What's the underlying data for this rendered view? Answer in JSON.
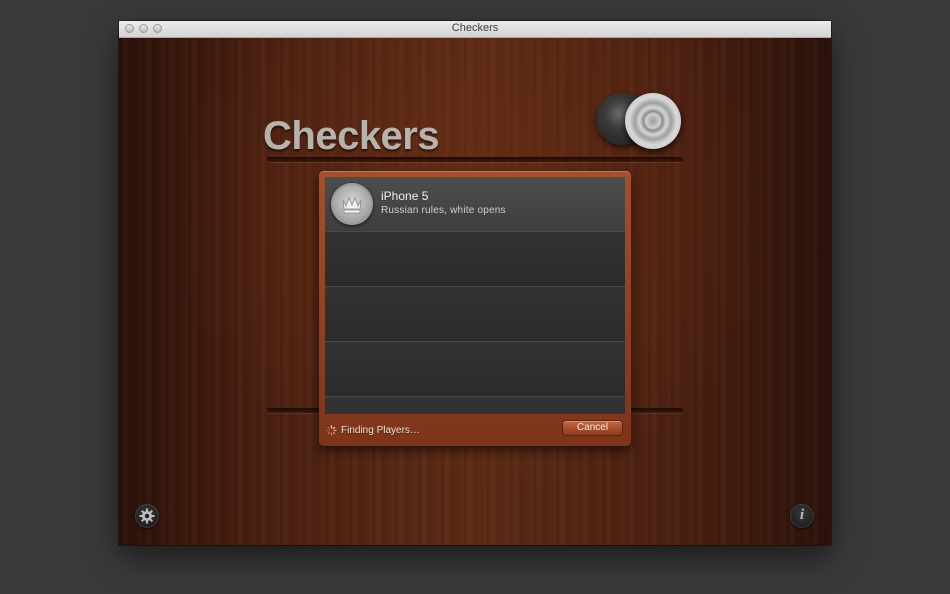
{
  "window": {
    "title": "Checkers"
  },
  "app": {
    "title": "Checkers"
  },
  "players": [
    {
      "name": "iPhone 5",
      "rules": "Russian rules, white opens",
      "icon": "king-crown-icon",
      "selected": true
    }
  ],
  "matchmaking": {
    "status": "Finding Players…",
    "cancel_label": "Cancel"
  },
  "icons": {
    "settings": "gear-icon",
    "info": "info-icon"
  },
  "colors": {
    "panel": "#a4502c",
    "title_text": "#b7b2ab"
  }
}
